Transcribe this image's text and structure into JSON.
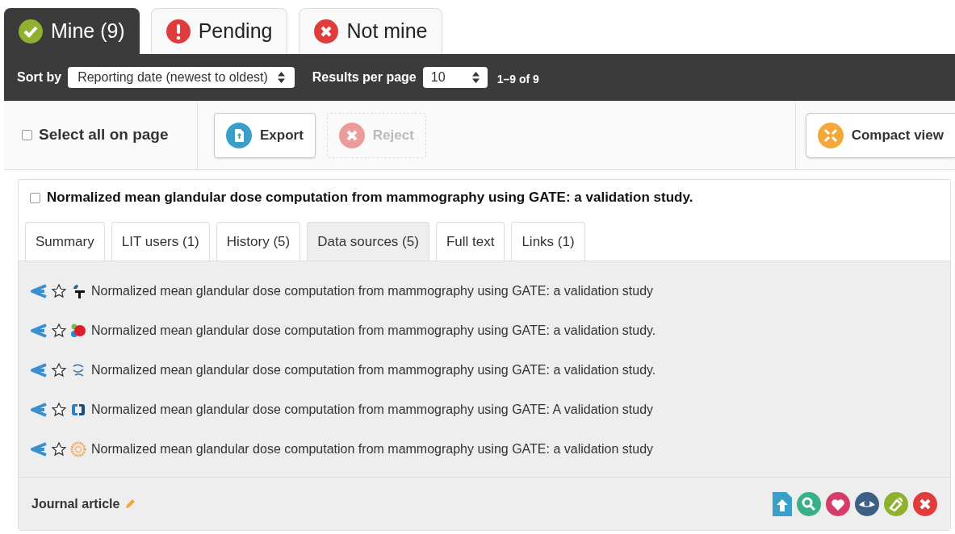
{
  "status_tabs": [
    {
      "label": "Mine (9)",
      "kind": "check",
      "selected": true
    },
    {
      "label": "Pending",
      "kind": "alert",
      "selected": false
    },
    {
      "label": "Not mine",
      "kind": "cross",
      "selected": false
    }
  ],
  "sort_bar": {
    "sort_label": "Sort by",
    "sort_value": "Reporting date (newest to oldest)",
    "per_page_label": "Results per page",
    "per_page_value": "10",
    "range": "1–9 of 9"
  },
  "toolbar": {
    "select_all": {
      "label": "Select all on page",
      "checked": false
    },
    "buttons": [
      {
        "label": "Export",
        "kind": "export",
        "disabled": false
      },
      {
        "label": "Reject",
        "kind": "reject",
        "disabled": true
      }
    ],
    "compact": {
      "label": "Compact view"
    }
  },
  "record": {
    "checked": false,
    "title": "Normalized mean glandular dose computation from mammography using GATE: a validation study.",
    "tabs": [
      {
        "label": "Summary",
        "selected": false
      },
      {
        "label": "LIT users (1)",
        "selected": false
      },
      {
        "label": "History (5)",
        "selected": false
      },
      {
        "label": "Data sources (5)",
        "selected": true
      },
      {
        "label": "Full text",
        "selected": false
      },
      {
        "label": "Links (1)",
        "selected": false
      }
    ],
    "sources": [
      {
        "kind": "hook",
        "starred": false,
        "title": "Normalized mean glandular dose computation from mammography using GATE: a validation study"
      },
      {
        "kind": "blobs",
        "starred": false,
        "title": "Normalized mean glandular dose computation from mammography using GATE: a validation study."
      },
      {
        "kind": "wave",
        "starred": false,
        "title": "Normalized mean glandular dose computation from mammography using GATE: a validation study."
      },
      {
        "kind": "ring",
        "starred": false,
        "title": "Normalized mean glandular dose computation from mammography using GATE: A validation study"
      },
      {
        "kind": "sun",
        "starred": false,
        "title": "Normalized mean glandular dose computation from mammography using GATE: a validation study"
      }
    ],
    "type_label": "Journal article"
  }
}
